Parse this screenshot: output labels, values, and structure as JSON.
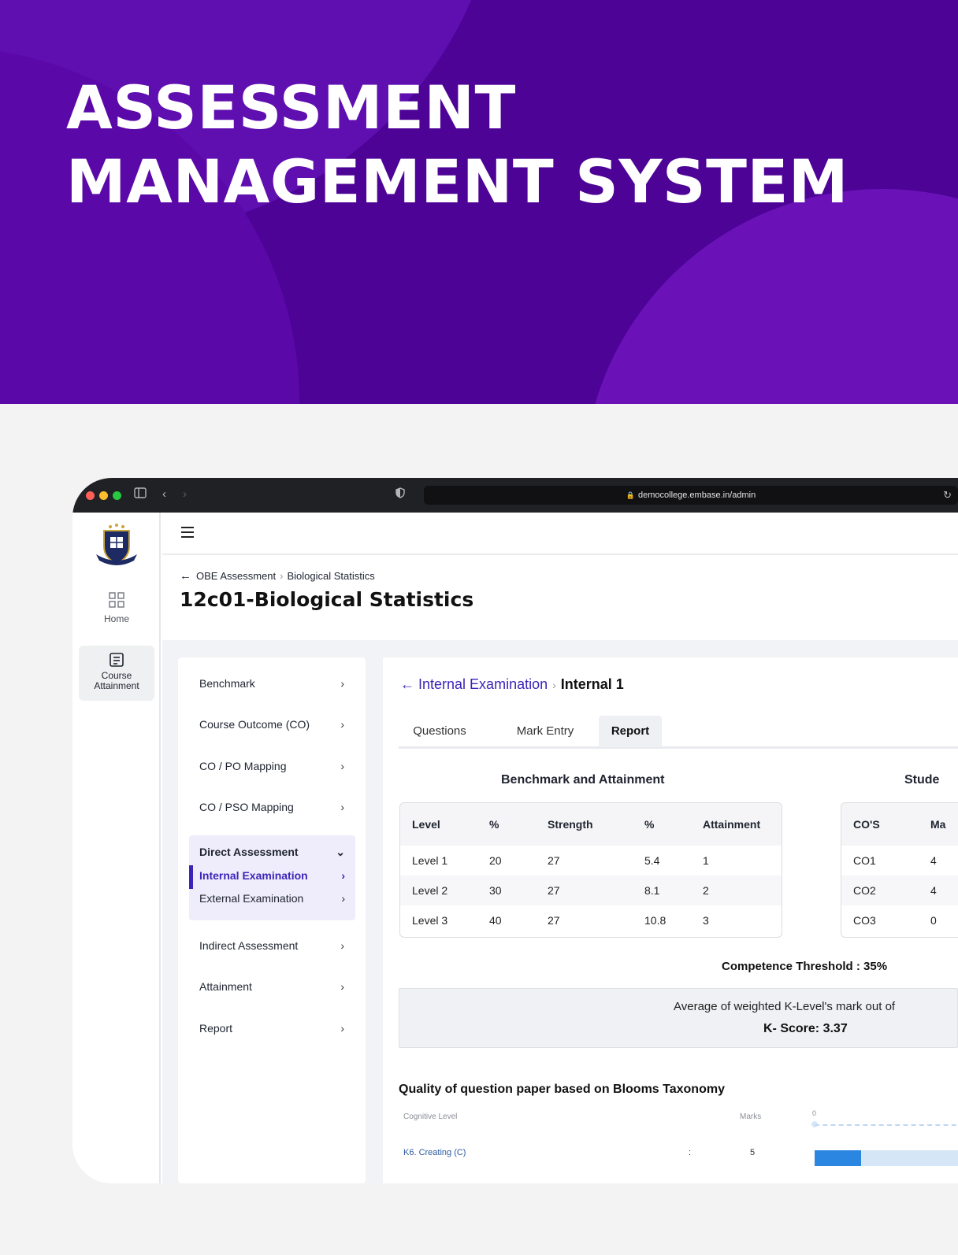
{
  "hero": {
    "title_line1": "ASSESSMENT",
    "title_line2": "MANAGEMENT SYSTEM"
  },
  "browser": {
    "url": "democollege.embase.in/admin"
  },
  "rail": {
    "home_label": "Home",
    "course_label_line1": "Course",
    "course_label_line2": "Attainment"
  },
  "header": {
    "crumb_parent": "OBE Assessment",
    "crumb_current": "Biological Statistics",
    "title": "12c01-Biological Statistics"
  },
  "nav": {
    "items": [
      {
        "label": "Benchmark"
      },
      {
        "label": "Course Outcome (CO)"
      },
      {
        "label": "CO / PO Mapping"
      },
      {
        "label": "CO / PSO Mapping"
      },
      {
        "label": "Indirect Assessment"
      },
      {
        "label": "Attainment"
      },
      {
        "label": "Report"
      }
    ],
    "group": {
      "label": "Direct Assessment",
      "subs": [
        {
          "label": "Internal Examination"
        },
        {
          "label": "External Examination"
        }
      ]
    }
  },
  "panel": {
    "crumb_back": "Internal Examination",
    "crumb_current": "Internal 1",
    "tabs": [
      {
        "label": "Questions"
      },
      {
        "label": "Mark Entry"
      },
      {
        "label": "Report"
      }
    ],
    "active_tab": "Report",
    "benchmark": {
      "title": "Benchmark and Attainment",
      "headers": [
        "Level",
        "%",
        "Strength",
        "%",
        "Attainment"
      ],
      "rows": [
        [
          "Level 1",
          "20",
          "27",
          "5.4",
          "1"
        ],
        [
          "Level 2",
          "30",
          "27",
          "8.1",
          "2"
        ],
        [
          "Level 3",
          "40",
          "27",
          "10.8",
          "3"
        ]
      ]
    },
    "students": {
      "title": "Stude",
      "headers": [
        "CO'S",
        "Ma"
      ],
      "rows": [
        [
          "CO1",
          "4"
        ],
        [
          "CO2",
          "4"
        ],
        [
          "CO3",
          "0"
        ]
      ]
    },
    "threshold": "Competence Threshold : 35%",
    "k_text": "Average of weighted K-Level's mark out of",
    "k_score": "K- Score: 3.37",
    "bloom": {
      "title": "Quality of question paper based on Blooms Taxonomy",
      "col_level": "Cognitive Level",
      "col_marks": "Marks",
      "axis_zero": "0",
      "row_label": "K6. Creating (C)",
      "row_colon": ":",
      "row_marks": "5",
      "row_fraction": 0.31
    }
  },
  "colors": {
    "hero_bg": "#4d0396",
    "accent": "#3d24b8",
    "bar_fill": "#2a86e0"
  }
}
